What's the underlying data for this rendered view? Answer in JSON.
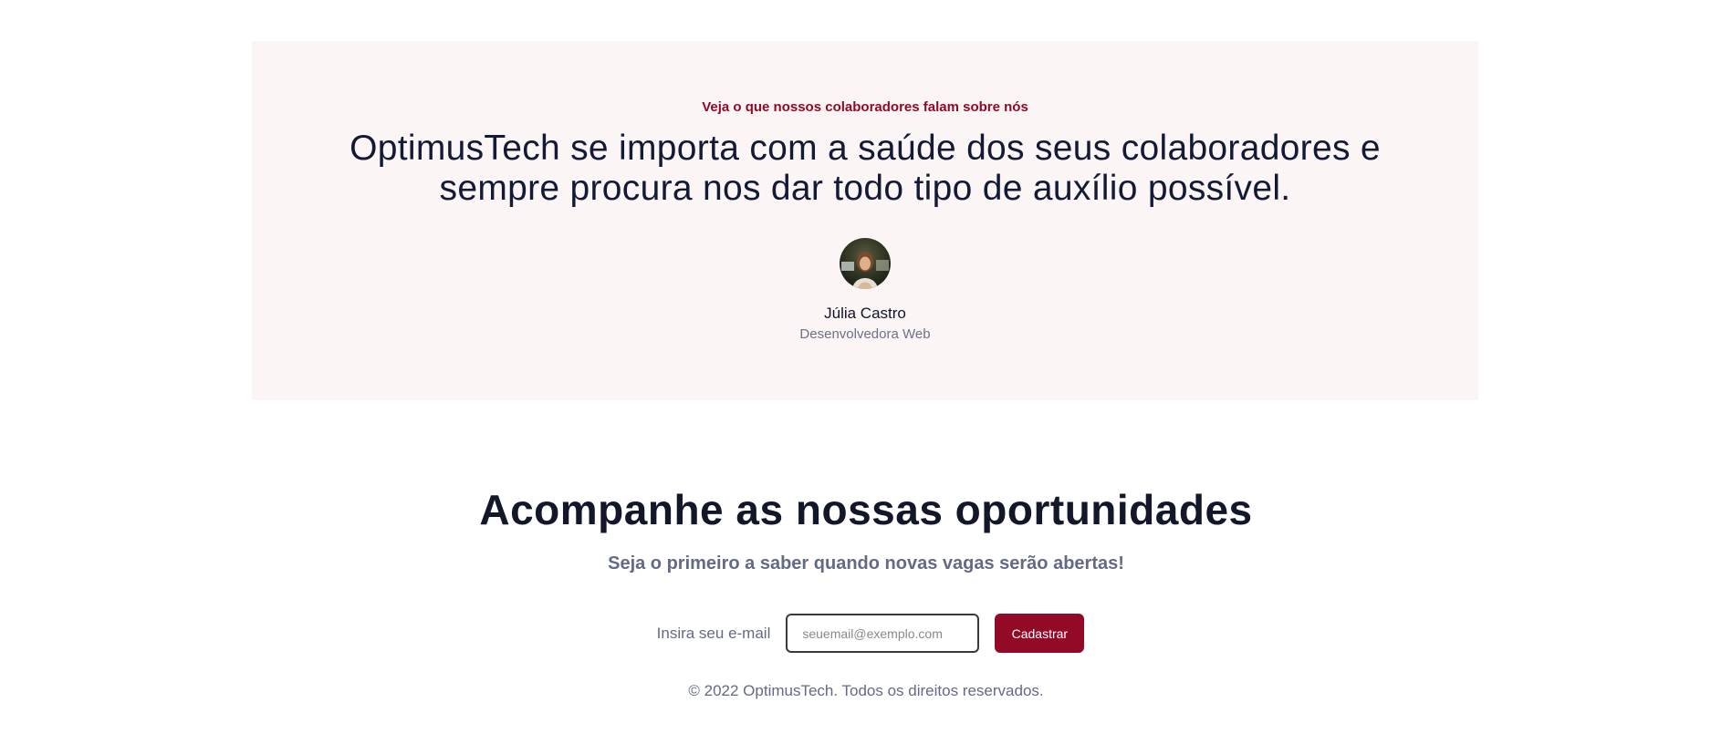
{
  "testimonial": {
    "eyebrow": "Veja o que nossos colaboradores falam sobre nós",
    "quote_line1": "OptimusTech se importa com a saúde dos seus colaboradores e",
    "quote_line2": "sempre procura nos dar todo tipo de auxílio possível.",
    "person_name": "Júlia Castro",
    "person_role": "Desenvolvedora Web"
  },
  "newsletter": {
    "title": "Acompanhe as nossas oportunidades",
    "subtitle": "Seja o primeiro a saber quando novas vagas serão abertas!",
    "email_label": "Insira seu e-mail",
    "email_placeholder": "seuemail@exemplo.com",
    "email_value": "",
    "submit_label": "Cadastrar"
  },
  "footer": {
    "copyright": "© 2022 OptimusTech. Todos os direitos reservados."
  },
  "colors": {
    "accent": "#920a26",
    "testimonial_bg": "#fcf5f5",
    "heading": "#121729",
    "muted": "#646a84"
  }
}
